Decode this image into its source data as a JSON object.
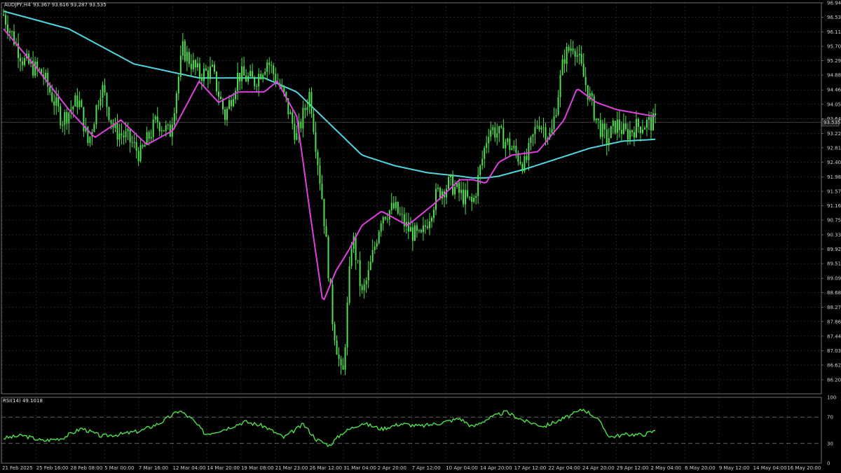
{
  "window": {
    "symbol_header": "AUDJPY,H4",
    "ohlc_header": "93.367 93.616 93.287 93.535",
    "rsi_header": "RSI(14) 49.1018",
    "current_price_label": "93.535"
  },
  "colors": {
    "background": "#000000",
    "grid": "#3a3a3a",
    "candles": "#4ee04e",
    "ma_fast": "#e040e0",
    "ma_slow": "#4fd6e0",
    "rsi_line": "#4ee04e",
    "axis_text": "#cfcfcf"
  },
  "chart_data": [
    {
      "type": "candlestick",
      "title": "AUDJPY,H4",
      "ylim": [
        85.8,
        96.94
      ],
      "y_tick_labels": [
        "96.940",
        "96.530",
        "96.110",
        "95.700",
        "95.290",
        "94.880",
        "94.460",
        "94.050",
        "93.640",
        "93.220",
        "92.810",
        "92.400",
        "91.980",
        "91.570",
        "91.160",
        "90.750",
        "90.330",
        "89.920",
        "89.510",
        "89.090",
        "88.680",
        "88.270",
        "87.860",
        "87.440",
        "87.030",
        "86.620",
        "86.200"
      ],
      "x_tick_labels": [
        "21 Feb 2025",
        "25 Feb 16:00",
        "28 Feb 08:00",
        "5 Mar 00:00",
        "7 Mar 16:00",
        "12 Mar 04:00",
        "14 Mar 20:00",
        "19 Mar 08:00",
        "21 Mar 23:00",
        "26 Mar 12:00",
        "31 Mar 04:00",
        "2 Apr 20:00",
        "7 Apr 12:00",
        "10 Apr 04:00",
        "14 Apr 20:00",
        "17 Apr 12:00",
        "22 Apr 04:00",
        "24 Apr 20:00",
        "29 Apr 12:00",
        "2 May 04:00",
        "6 May 20:00",
        "9 May 12:00",
        "14 May 04:00",
        "16 May 20:00"
      ],
      "price_path_x": [
        0,
        0.03,
        0.06,
        0.09,
        0.115,
        0.13,
        0.15,
        0.17,
        0.19,
        0.21,
        0.235,
        0.255,
        0.275,
        0.3,
        0.32,
        0.34,
        0.36,
        0.385,
        0.405,
        0.43,
        0.45,
        0.47,
        0.49,
        0.505,
        0.52,
        0.535,
        0.55,
        0.56,
        0.58,
        0.6,
        0.62,
        0.64,
        0.665,
        0.685,
        0.7,
        0.72,
        0.745,
        0.76,
        0.78,
        0.8,
        0.82,
        0.84,
        0.86,
        0.875,
        0.895,
        0.91,
        0.925,
        0.94,
        0.955,
        0.97,
        0.985,
        1.0
      ],
      "price_path_y": [
        96.6,
        95.3,
        94.9,
        93.6,
        94.2,
        92.9,
        94.6,
        93.3,
        93.1,
        92.6,
        93.6,
        93.2,
        95.6,
        94.9,
        95.0,
        93.7,
        94.9,
        94.7,
        95.3,
        94.3,
        93.1,
        94.4,
        91.2,
        87.9,
        86.1,
        90.4,
        88.6,
        89.2,
        90.9,
        91.1,
        90.5,
        90.2,
        91.5,
        91.8,
        91.5,
        91.2,
        93.4,
        93.2,
        92.8,
        92.3,
        93.6,
        93.1,
        95.4,
        95.8,
        94.5,
        93.6,
        93.0,
        93.5,
        93.2,
        93.4,
        93.5,
        93.535
      ],
      "series": [
        {
          "name": "",
          "kind": "moving-average-fast",
          "x": [
            0,
            0.05,
            0.1,
            0.14,
            0.18,
            0.22,
            0.26,
            0.3,
            0.33,
            0.36,
            0.4,
            0.42,
            0.45,
            0.47,
            0.49,
            0.51,
            0.53,
            0.55,
            0.58,
            0.62,
            0.66,
            0.7,
            0.72,
            0.74,
            0.76,
            0.78,
            0.82,
            0.86,
            0.88,
            0.91,
            0.94,
            0.97,
            1.0
          ],
          "y": [
            96.2,
            95.1,
            93.9,
            93.1,
            93.6,
            92.9,
            93.3,
            94.7,
            94.1,
            94.4,
            94.4,
            94.7,
            93.7,
            91.0,
            88.4,
            89.3,
            89.9,
            90.6,
            91.0,
            90.6,
            91.2,
            91.9,
            91.9,
            91.8,
            92.4,
            92.6,
            92.7,
            93.6,
            94.5,
            94.1,
            93.9,
            93.8,
            93.7
          ]
        },
        {
          "name": "",
          "kind": "moving-average-slow",
          "x": [
            0,
            0.1,
            0.2,
            0.3,
            0.4,
            0.45,
            0.5,
            0.55,
            0.6,
            0.65,
            0.7,
            0.72,
            0.74,
            0.76,
            0.8,
            0.85,
            0.9,
            0.95,
            1.0
          ],
          "y": [
            96.7,
            96.2,
            95.2,
            94.8,
            94.8,
            94.4,
            93.5,
            92.6,
            92.3,
            92.1,
            92.0,
            91.95,
            91.95,
            92.0,
            92.2,
            92.5,
            92.8,
            93.0,
            93.05
          ]
        }
      ]
    },
    {
      "type": "line",
      "title": "RSI(14) 49.1018",
      "ylim": [
        0,
        100
      ],
      "y_tick_labels": [
        "100",
        "70",
        "30",
        "0"
      ],
      "levels": [
        70,
        30
      ],
      "x": [
        0,
        0.03,
        0.06,
        0.09,
        0.12,
        0.15,
        0.18,
        0.21,
        0.24,
        0.27,
        0.29,
        0.31,
        0.34,
        0.37,
        0.4,
        0.43,
        0.46,
        0.48,
        0.5,
        0.52,
        0.55,
        0.58,
        0.61,
        0.64,
        0.67,
        0.7,
        0.72,
        0.74,
        0.77,
        0.8,
        0.83,
        0.86,
        0.89,
        0.91,
        0.93,
        0.96,
        0.98,
        1.0
      ],
      "y": [
        38,
        42,
        34,
        38,
        53,
        41,
        44,
        49,
        61,
        80,
        66,
        44,
        52,
        63,
        56,
        39,
        59,
        36,
        27,
        46,
        61,
        52,
        60,
        56,
        61,
        68,
        55,
        66,
        78,
        64,
        56,
        68,
        82,
        69,
        40,
        44,
        43,
        49.1
      ]
    }
  ]
}
